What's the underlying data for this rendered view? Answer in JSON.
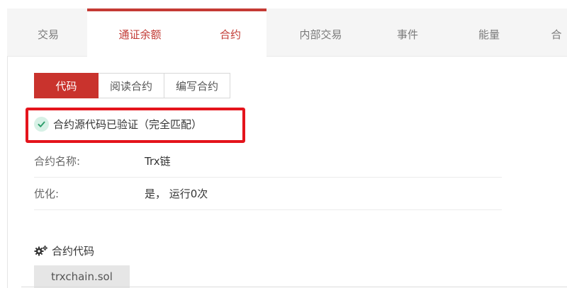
{
  "tabs": [
    {
      "label": "交易",
      "active": false
    },
    {
      "label": "通证余额",
      "active": true
    },
    {
      "label": "合约",
      "active": true
    },
    {
      "label": "内部交易",
      "active": false
    },
    {
      "label": "事件",
      "active": false
    },
    {
      "label": "能量",
      "active": false
    },
    {
      "label": "合",
      "active": false
    }
  ],
  "subtabs": [
    {
      "label": "代码",
      "active": true
    },
    {
      "label": "阅读合约",
      "active": false
    },
    {
      "label": "编写合约",
      "active": false
    }
  ],
  "verification": {
    "text": "合约源代码已验证（完全匹配）"
  },
  "details": {
    "name_label": "合约名称:",
    "name_value": "Trx链",
    "optimize_label": "优化:",
    "optimize_value": "是， 运行0次"
  },
  "code_section": {
    "title": "合约代码",
    "file_name": "trxchain.sol"
  },
  "colors": {
    "accent": "#c9332d",
    "highlight": "#e4141c",
    "check_bg": "#d7f1e6",
    "check_mark": "#2e9e6b"
  }
}
